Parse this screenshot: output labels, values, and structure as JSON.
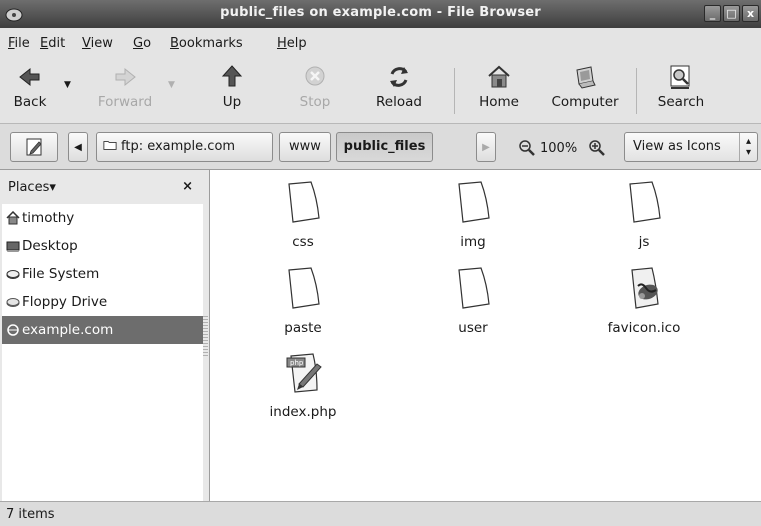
{
  "window": {
    "title": "public_files on example.com - File Browser",
    "icon": "file-browser-icon",
    "controls": [
      "_",
      "□",
      "x"
    ]
  },
  "menubar": {
    "items": [
      {
        "label": "File",
        "mnemonic": "F",
        "rest": "ile"
      },
      {
        "label": "Edit",
        "mnemonic": "E",
        "rest": "dit"
      },
      {
        "label": "View",
        "mnemonic": "V",
        "rest": "iew"
      },
      {
        "label": "Go",
        "mnemonic": "G",
        "rest": "o"
      },
      {
        "label": "Bookmarks",
        "mnemonic": "B",
        "rest": "ookmarks"
      },
      {
        "label": "Help",
        "mnemonic": "H",
        "rest": "elp"
      }
    ]
  },
  "toolbar": {
    "back": {
      "label": "Back",
      "icon": "back-arrow-icon",
      "enabled": true
    },
    "forward": {
      "label": "Forward",
      "icon": "forward-arrow-icon",
      "enabled": false
    },
    "up": {
      "label": "Up",
      "icon": "up-arrow-icon",
      "enabled": true
    },
    "stop": {
      "label": "Stop",
      "icon": "stop-icon",
      "enabled": false
    },
    "reload": {
      "label": "Reload",
      "icon": "reload-icon",
      "enabled": true
    },
    "home": {
      "label": "Home",
      "icon": "home-icon",
      "enabled": true
    },
    "computer": {
      "label": "Computer",
      "icon": "computer-icon",
      "enabled": true
    },
    "search": {
      "label": "Search",
      "icon": "search-icon",
      "enabled": true
    }
  },
  "location": {
    "path_buttons": [
      "ftp: example.com",
      "www",
      "public_files"
    ],
    "active_path": "public_files",
    "zoom": "100%",
    "view_mode": "View as Icons"
  },
  "sidebar": {
    "header": "Places",
    "header_arrow": "▾",
    "close": "×",
    "items": [
      {
        "label": "timothy",
        "icon": "home-folder-icon",
        "selected": false
      },
      {
        "label": "Desktop",
        "icon": "desktop-icon",
        "selected": false
      },
      {
        "label": "File System",
        "icon": "drive-icon",
        "selected": false
      },
      {
        "label": "Floppy Drive",
        "icon": "floppy-icon",
        "selected": false
      },
      {
        "label": "example.com",
        "icon": "network-icon",
        "selected": true
      }
    ]
  },
  "files": [
    {
      "name": "css",
      "type": "folder"
    },
    {
      "name": "img",
      "type": "folder"
    },
    {
      "name": "js",
      "type": "folder"
    },
    {
      "name": "paste",
      "type": "folder"
    },
    {
      "name": "user",
      "type": "folder"
    },
    {
      "name": "favicon.ico",
      "type": "image"
    },
    {
      "name": "index.php",
      "type": "php"
    }
  ],
  "status": {
    "text": "7 items"
  }
}
